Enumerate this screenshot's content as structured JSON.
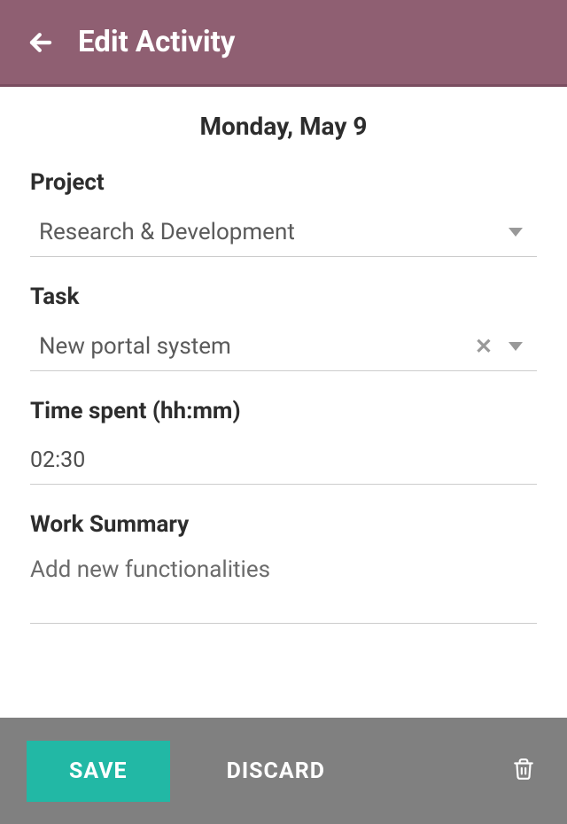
{
  "header": {
    "title": "Edit Activity"
  },
  "date": "Monday, May 9",
  "fields": {
    "project": {
      "label": "Project",
      "value": "Research & Development"
    },
    "task": {
      "label": "Task",
      "value": "New portal system"
    },
    "time": {
      "label": "Time spent (hh:mm)",
      "value": "02:30"
    },
    "summary": {
      "label": "Work Summary",
      "value": "Add new functionalities"
    }
  },
  "footer": {
    "save": "SAVE",
    "discard": "DISCARD"
  }
}
